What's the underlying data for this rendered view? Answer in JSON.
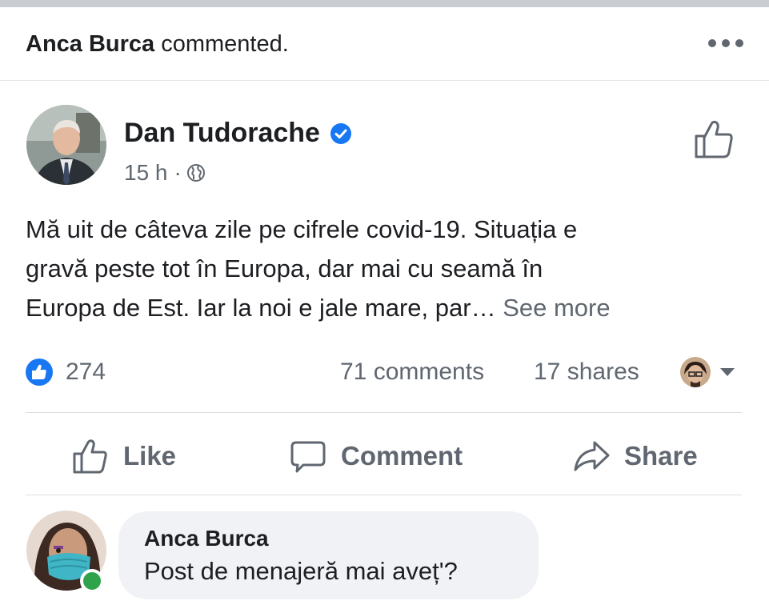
{
  "activity": {
    "actor": "Anca Burca",
    "action": "commented."
  },
  "post": {
    "author": "Dan Tudorache",
    "time": "15 h",
    "separator": "·",
    "text_lines": [
      "Mă uit de câteva zile pe cifrele covid-19. Situația e",
      "gravă peste tot în Europa, dar mai cu seamă în",
      "Europa de Est. Iar la noi e jale mare, par… "
    ],
    "see_more": "See more",
    "reactions_count": "274",
    "comments_count": "71 comments",
    "shares_count": "17 shares"
  },
  "actions": {
    "like": "Like",
    "comment": "Comment",
    "share": "Share"
  },
  "comment": {
    "author": "Anca Burca",
    "text": "Post de menajeră mai aveț'?"
  },
  "icons": {
    "more": "more-horizontal-icon",
    "verified": "verified-badge-icon",
    "privacy": "globe-icon",
    "like_page": "thumbs-up-outline-icon",
    "like_reaction": "like-reaction-icon",
    "comment": "speech-bubble-icon",
    "share": "share-arrow-icon",
    "viewer_menu": "caret-down-icon"
  },
  "colors": {
    "accent": "#1877f2",
    "secondary_text": "#606770",
    "online": "#31a24c",
    "bubble": "#f0f2f5"
  }
}
